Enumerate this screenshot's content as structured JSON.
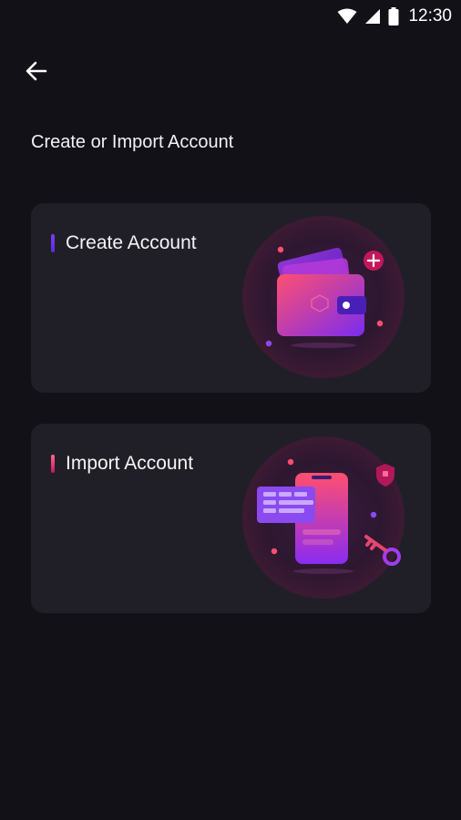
{
  "status_bar": {
    "time": "12:30",
    "icons": [
      "wifi-icon",
      "signal-icon",
      "battery-icon"
    ]
  },
  "header": {
    "back_icon": "arrow-left-icon",
    "title": "Create or Import Account"
  },
  "options": [
    {
      "label": "Create Account",
      "illustration": "wallet-illustration"
    },
    {
      "label": "Import Account",
      "illustration": "phone-key-illustration"
    }
  ],
  "colors": {
    "background": "#121118",
    "card": "#201f27",
    "accent_purple": "#6a33e8",
    "accent_pink": "#e6456f"
  }
}
